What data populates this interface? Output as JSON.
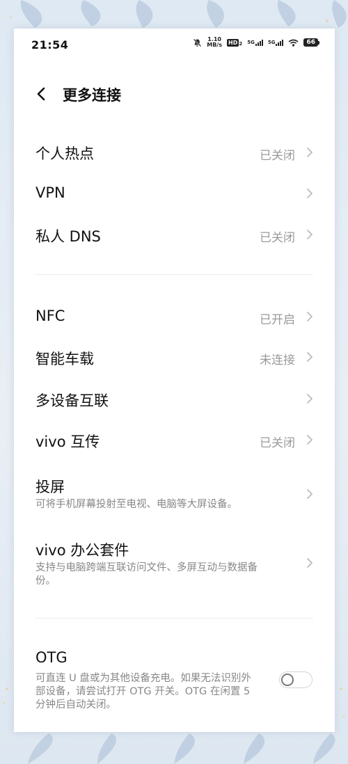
{
  "status_bar": {
    "time": "21:54",
    "net_speed_value": "1.10",
    "net_speed_unit": "MB/s",
    "hd_label": "HD",
    "hd_sub": "2",
    "sim1_label": "5G",
    "sim2_label": "5G",
    "battery": "66",
    "icons": [
      "mute-bell-icon",
      "hd-voice-icon",
      "signal-icon",
      "signal-icon",
      "wifi-icon",
      "battery-icon"
    ]
  },
  "header": {
    "title": "更多连接",
    "back_icon": "chevron-left-icon"
  },
  "settings": {
    "hotspot": {
      "title": "个人热点",
      "status": "已关闭"
    },
    "vpn": {
      "title": "VPN"
    },
    "private_dns": {
      "title": "私人 DNS",
      "status": "已关闭"
    },
    "nfc": {
      "title": "NFC",
      "status": "已开启"
    },
    "car": {
      "title": "智能车载",
      "status": "未连接"
    },
    "multi_device": {
      "title": "多设备互联"
    },
    "vivo_share": {
      "title": "vivo 互传",
      "status": "已关闭"
    },
    "screen_cast": {
      "title": "投屏",
      "desc": "可将手机屏幕投射至电视、电脑等大屏设备。"
    },
    "office_suite": {
      "title": "vivo 办公套件",
      "desc": "支持与电脑跨端互联访问文件、多屏互动与数据备份。"
    },
    "otg": {
      "title": "OTG",
      "desc": "可直连 U 盘或为其他设备充电。如果无法识别外部设备，请尝试打开 OTG 开关。OTG 在闲置 5 分钟后自动关闭。",
      "enabled": false
    }
  },
  "colors": {
    "status_text": "#9a9a9a",
    "chevron": "#bbbbbb",
    "toggle_knob": "#777777"
  }
}
